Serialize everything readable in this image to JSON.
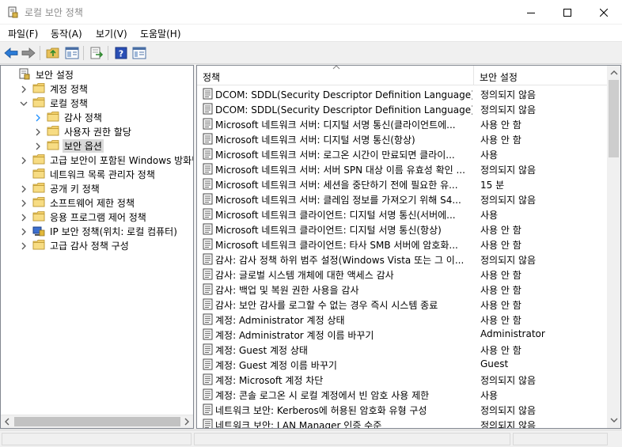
{
  "window": {
    "title": "로컬 보안 정책"
  },
  "menu": [
    {
      "label": "파일(F)"
    },
    {
      "label": "동작(A)"
    },
    {
      "label": "보기(V)"
    },
    {
      "label": "도움말(H)"
    }
  ],
  "tree": [
    {
      "label": "보안 설정",
      "icon": "settings-doc-icon",
      "expand": "none",
      "indent": 0
    },
    {
      "label": "계정 정책",
      "icon": "folder-icon",
      "expand": "collapsed",
      "indent": 1
    },
    {
      "label": "로컬 정책",
      "icon": "folder-icon",
      "expand": "expanded",
      "indent": 1
    },
    {
      "label": "감사 정책",
      "icon": "folder-icon",
      "expand": "collapsed-blue",
      "indent": 2
    },
    {
      "label": "사용자 권한 할당",
      "icon": "folder-icon",
      "expand": "collapsed",
      "indent": 2
    },
    {
      "label": "보안 옵션",
      "icon": "folder-icon",
      "expand": "collapsed",
      "indent": 2,
      "selected": true
    },
    {
      "label": "고급 보안이 포함된 Windows 방화벽",
      "icon": "folder-icon",
      "expand": "collapsed",
      "indent": 1
    },
    {
      "label": "네트워크 목록 관리자 정책",
      "icon": "folder-icon",
      "expand": "none",
      "indent": 1
    },
    {
      "label": "공개 키 정책",
      "icon": "folder-icon",
      "expand": "collapsed",
      "indent": 1
    },
    {
      "label": "소프트웨어 제한 정책",
      "icon": "folder-icon",
      "expand": "collapsed",
      "indent": 1
    },
    {
      "label": "응용 프로그램 제어 정책",
      "icon": "folder-icon",
      "expand": "collapsed",
      "indent": 1
    },
    {
      "label": "IP 보안 정책(위치: 로컬 컴퓨터)",
      "icon": "ip-security-icon",
      "expand": "collapsed",
      "indent": 1
    },
    {
      "label": "고급 감사 정책 구성",
      "icon": "folder-icon",
      "expand": "collapsed",
      "indent": 1
    }
  ],
  "list": {
    "columns": {
      "policy": "정책",
      "setting": "보안 설정"
    },
    "rows": [
      {
        "policy": "DCOM: SDDL(Security Descriptor Definition Language) 구...",
        "setting": "정의되지 않음"
      },
      {
        "policy": "DCOM: SDDL(Security Descriptor Definition Language) 구...",
        "setting": "정의되지 않음"
      },
      {
        "policy": "Microsoft 네트워크 서버: 디지털 서명 통신(클라이언트에...",
        "setting": "사용 안 함"
      },
      {
        "policy": "Microsoft 네트워크 서버: 디지털 서명 통신(항상)",
        "setting": "사용 안 함"
      },
      {
        "policy": "Microsoft 네트워크 서버: 로그온 시간이 만료되면 클라이...",
        "setting": "사용"
      },
      {
        "policy": "Microsoft 네트워크 서버: 서버 SPN 대상 이름 유효성 확인 ...",
        "setting": "정의되지 않음"
      },
      {
        "policy": "Microsoft 네트워크 서버: 세션을 중단하기 전에 필요한 유...",
        "setting": "15 분"
      },
      {
        "policy": "Microsoft 네트워크 서버: 클레임 정보를 가져오기 위해 S4...",
        "setting": "정의되지 않음"
      },
      {
        "policy": "Microsoft 네트워크 클라이언트: 디지털 서명 통신(서버에...",
        "setting": "사용"
      },
      {
        "policy": "Microsoft 네트워크 클라이언트: 디지털 서명 통신(항상)",
        "setting": "사용 안 함"
      },
      {
        "policy": "Microsoft 네트워크 클라이언트: 타사 SMB 서버에 암호화...",
        "setting": "사용 안 함"
      },
      {
        "policy": "감사: 감사 정책 하위 범주 설정(Windows Vista 또는 그 이...",
        "setting": "정의되지 않음"
      },
      {
        "policy": "감사: 글로벌 시스템 개체에 대한 액세스 감사",
        "setting": "사용 안 함"
      },
      {
        "policy": "감사: 백업 및 복원 권한 사용을 감사",
        "setting": "사용 안 함"
      },
      {
        "policy": "감사: 보안 감사를 로그할 수 없는 경우 즉시 시스템 종료",
        "setting": "사용 안 함"
      },
      {
        "policy": "계정: Administrator 계정 상태",
        "setting": "사용 안 함"
      },
      {
        "policy": "계정: Administrator 계정 이름 바꾸기",
        "setting": "Administrator"
      },
      {
        "policy": "계정: Guest 계정 상태",
        "setting": "사용 안 함"
      },
      {
        "policy": "계정: Guest 계정 이름 바꾸기",
        "setting": "Guest"
      },
      {
        "policy": "계정: Microsoft 계정 차단",
        "setting": "정의되지 않음"
      },
      {
        "policy": "계정: 콘솔 로그온 시 로컬 계정에서 빈 암호 사용 제한",
        "setting": "사용"
      },
      {
        "policy": "네트워크 보안: Kerberos에 허용된 암호화 유형 구성",
        "setting": "정의되지 않음"
      },
      {
        "policy": "네트워크 보안: LAN Manager 인증 수준",
        "setting": "정의되지 않음"
      }
    ]
  }
}
